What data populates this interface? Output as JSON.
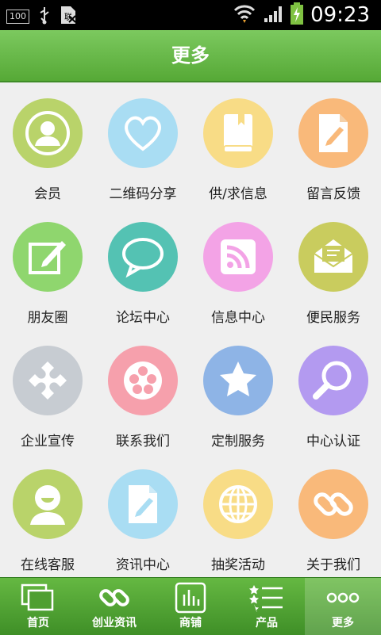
{
  "status_bar": {
    "time": "09:23",
    "battery_text": "100"
  },
  "header": {
    "title": "更多"
  },
  "grid": {
    "items": [
      {
        "label": "会员",
        "icon": "member-icon",
        "color": "#b9d36a"
      },
      {
        "label": "二维码分享",
        "icon": "heart-icon",
        "color": "#a9ddf3"
      },
      {
        "label": "供/求信息",
        "icon": "book-icon",
        "color": "#f8dc86"
      },
      {
        "label": "留言反馈",
        "icon": "note-edit-icon",
        "color": "#f9b97a"
      },
      {
        "label": "朋友圈",
        "icon": "edit-icon",
        "color": "#8fd66e"
      },
      {
        "label": "论坛中心",
        "icon": "chat-bubble-icon",
        "color": "#54c2b3"
      },
      {
        "label": "信息中心",
        "icon": "rss-icon",
        "color": "#f3a3e6"
      },
      {
        "label": "便民服务",
        "icon": "mail-icon",
        "color": "#c9cc5e"
      },
      {
        "label": "企业宣传",
        "icon": "puzzle-icon",
        "color": "#c7ccd2"
      },
      {
        "label": "联系我们",
        "icon": "film-reel-icon",
        "color": "#f6a0ac"
      },
      {
        "label": "定制服务",
        "icon": "star-icon",
        "color": "#8eb4e6"
      },
      {
        "label": "中心认证",
        "icon": "magnifier-icon",
        "color": "#b39af0"
      },
      {
        "label": "在线客服",
        "icon": "smiley-person-icon",
        "color": "#b9d36a"
      },
      {
        "label": "资讯中心",
        "icon": "document-edit-icon",
        "color": "#a9ddf3"
      },
      {
        "label": "抽奖活动",
        "icon": "globe-icon",
        "color": "#f8dc86"
      },
      {
        "label": "关于我们",
        "icon": "chain-link-icon",
        "color": "#f9b97a"
      }
    ]
  },
  "tabbar": {
    "tabs": [
      {
        "label": "首页",
        "icon": "windows-icon"
      },
      {
        "label": "创业资讯",
        "icon": "chain-link-icon"
      },
      {
        "label": "商铺",
        "icon": "bar-chart-icon"
      },
      {
        "label": "产品",
        "icon": "star-list-icon"
      },
      {
        "label": "更多",
        "icon": "more-dots-icon"
      }
    ]
  }
}
